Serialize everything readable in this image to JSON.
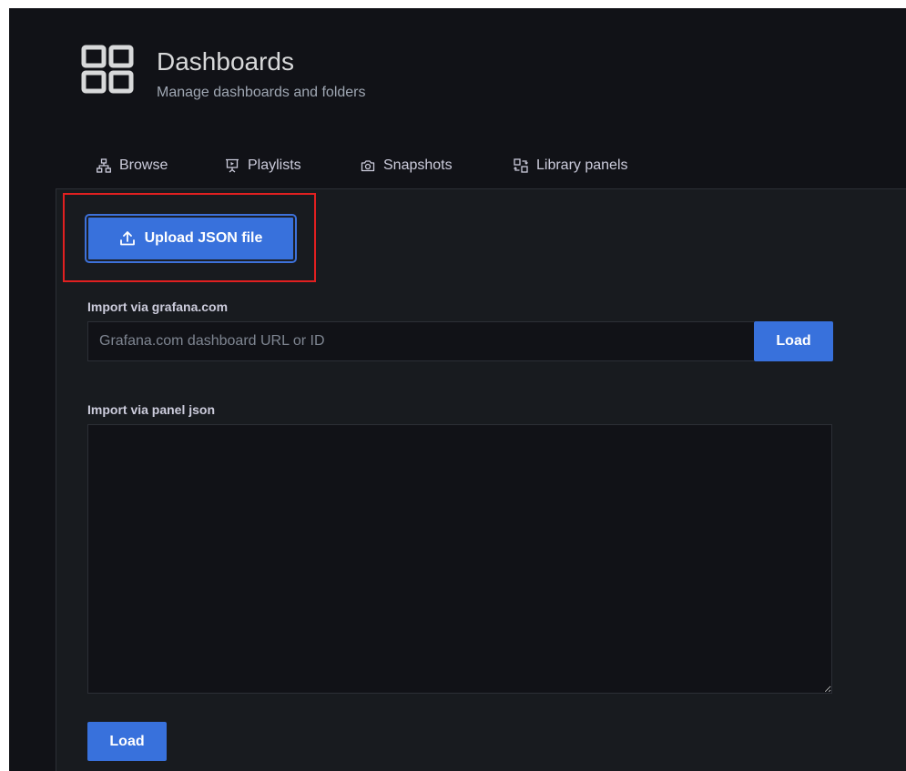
{
  "header": {
    "title": "Dashboards",
    "subtitle": "Manage dashboards and folders",
    "icon": "dashboards-grid-icon"
  },
  "tabs": [
    {
      "label": "Browse",
      "icon": "sitemap-icon"
    },
    {
      "label": "Playlists",
      "icon": "presentation-icon"
    },
    {
      "label": "Snapshots",
      "icon": "camera-icon"
    },
    {
      "label": "Library panels",
      "icon": "library-panel-icon"
    }
  ],
  "import": {
    "upload_label": "Upload JSON file",
    "grafana_com": {
      "label": "Import via grafana.com",
      "placeholder": "Grafana.com dashboard URL or ID",
      "value": "",
      "button_label": "Load"
    },
    "panel_json": {
      "label": "Import via panel json",
      "value": "",
      "button_label": "Load"
    }
  },
  "colors": {
    "primary_button": "#3871dc",
    "highlight": "#e02020",
    "background": "#111217",
    "panel_background": "#181b1f"
  }
}
